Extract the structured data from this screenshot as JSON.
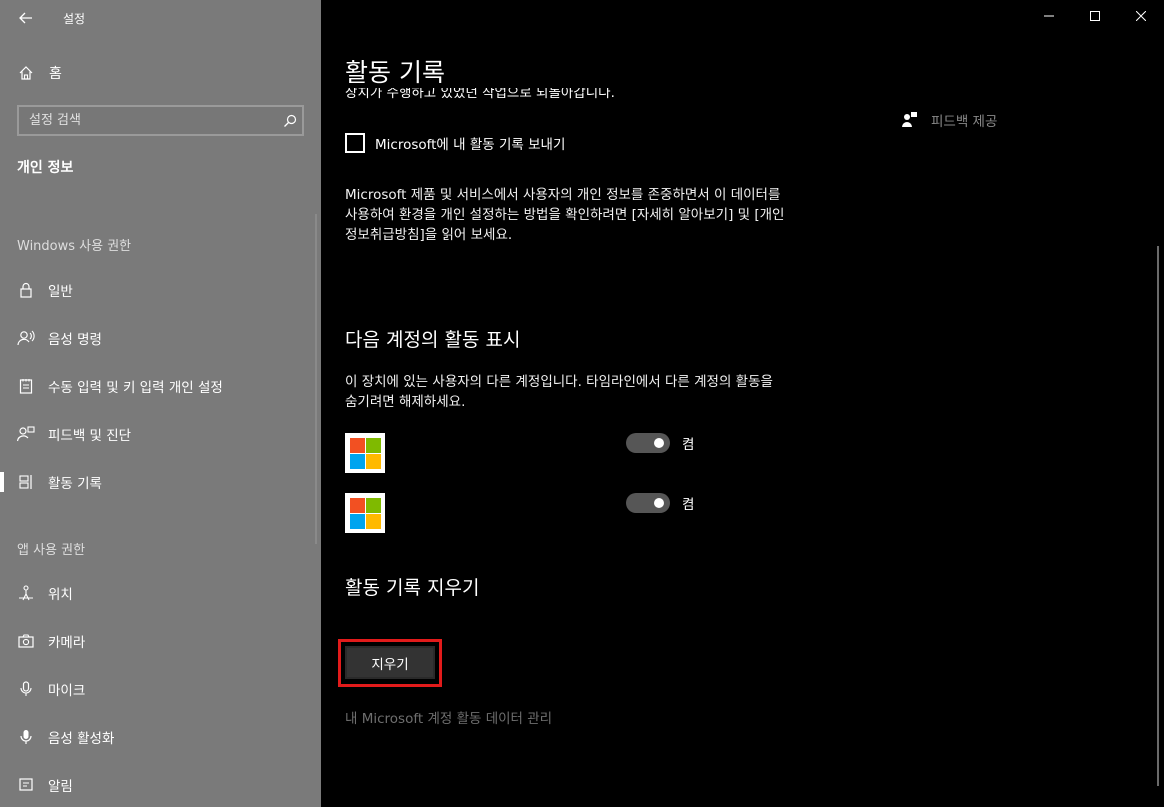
{
  "app": {
    "title": "설정",
    "back_icon": "back-arrow-icon"
  },
  "sidebar": {
    "home_label": "홈",
    "search": {
      "placeholder": "설정 검색"
    },
    "current_section": "개인 정보",
    "groups": [
      {
        "label": "Windows 사용 권한",
        "items": [
          {
            "label": "일반",
            "icon": "lock-icon"
          },
          {
            "label": "음성 명령",
            "icon": "speech-icon"
          },
          {
            "label": "수동 입력 및 키 입력 개인 설정",
            "icon": "notepad-icon"
          },
          {
            "label": "피드백 및 진단",
            "icon": "feedback-person-icon"
          },
          {
            "label": "활동 기록",
            "icon": "timeline-icon",
            "selected": true
          }
        ]
      },
      {
        "label": "앱 사용 권한",
        "items": [
          {
            "label": "위치",
            "icon": "location-icon"
          },
          {
            "label": "카메라",
            "icon": "camera-icon"
          },
          {
            "label": "마이크",
            "icon": "microphone-icon"
          },
          {
            "label": "음성 활성화",
            "icon": "voice-activation-icon"
          },
          {
            "label": "알림",
            "icon": "bell-icon"
          }
        ]
      }
    ]
  },
  "main": {
    "title": "활동 기록",
    "clipped_text": "장치가 수행하고 있었던 작업으로 되돌아갑니다.",
    "feedback_label": "피드백 제공",
    "send_checkbox": {
      "label": "Microsoft에 내 활동 기록 보내기",
      "checked": false
    },
    "privacy_text": "Microsoft 제품 및 서비스에서 사용자의 개인 정보를 존중하면서 이 데이터를 사용하여 환경을 개인 설정하는 방법을 확인하려면 [자세히 알아보기] 및 [개인정보취급방침]을 읽어 보세요.",
    "accounts_section": {
      "heading": "다음 계정의 활동 표시",
      "description": "이 장치에 있는 사용자의 다른 계정입니다. 타임라인에서 다른 계정의 활동을 숨기려면 해제하세요.",
      "accounts": [
        {
          "icon": "microsoft-logo-icon",
          "toggle_on": true,
          "toggle_label": "켬"
        },
        {
          "icon": "microsoft-logo-icon",
          "toggle_on": true,
          "toggle_label": "켬"
        }
      ]
    },
    "clear_section": {
      "heading": "활동 기록 지우기",
      "button_label": "지우기",
      "manage_link": "내 Microsoft 계정 활동 데이터 관리"
    }
  },
  "colors": {
    "sidebar_bg": "#7a7a7a",
    "main_bg": "#000000",
    "highlight": "#e21b1b",
    "ms_red": "#f25022",
    "ms_green": "#7fba00",
    "ms_blue": "#00a4ef",
    "ms_yellow": "#ffb900"
  }
}
